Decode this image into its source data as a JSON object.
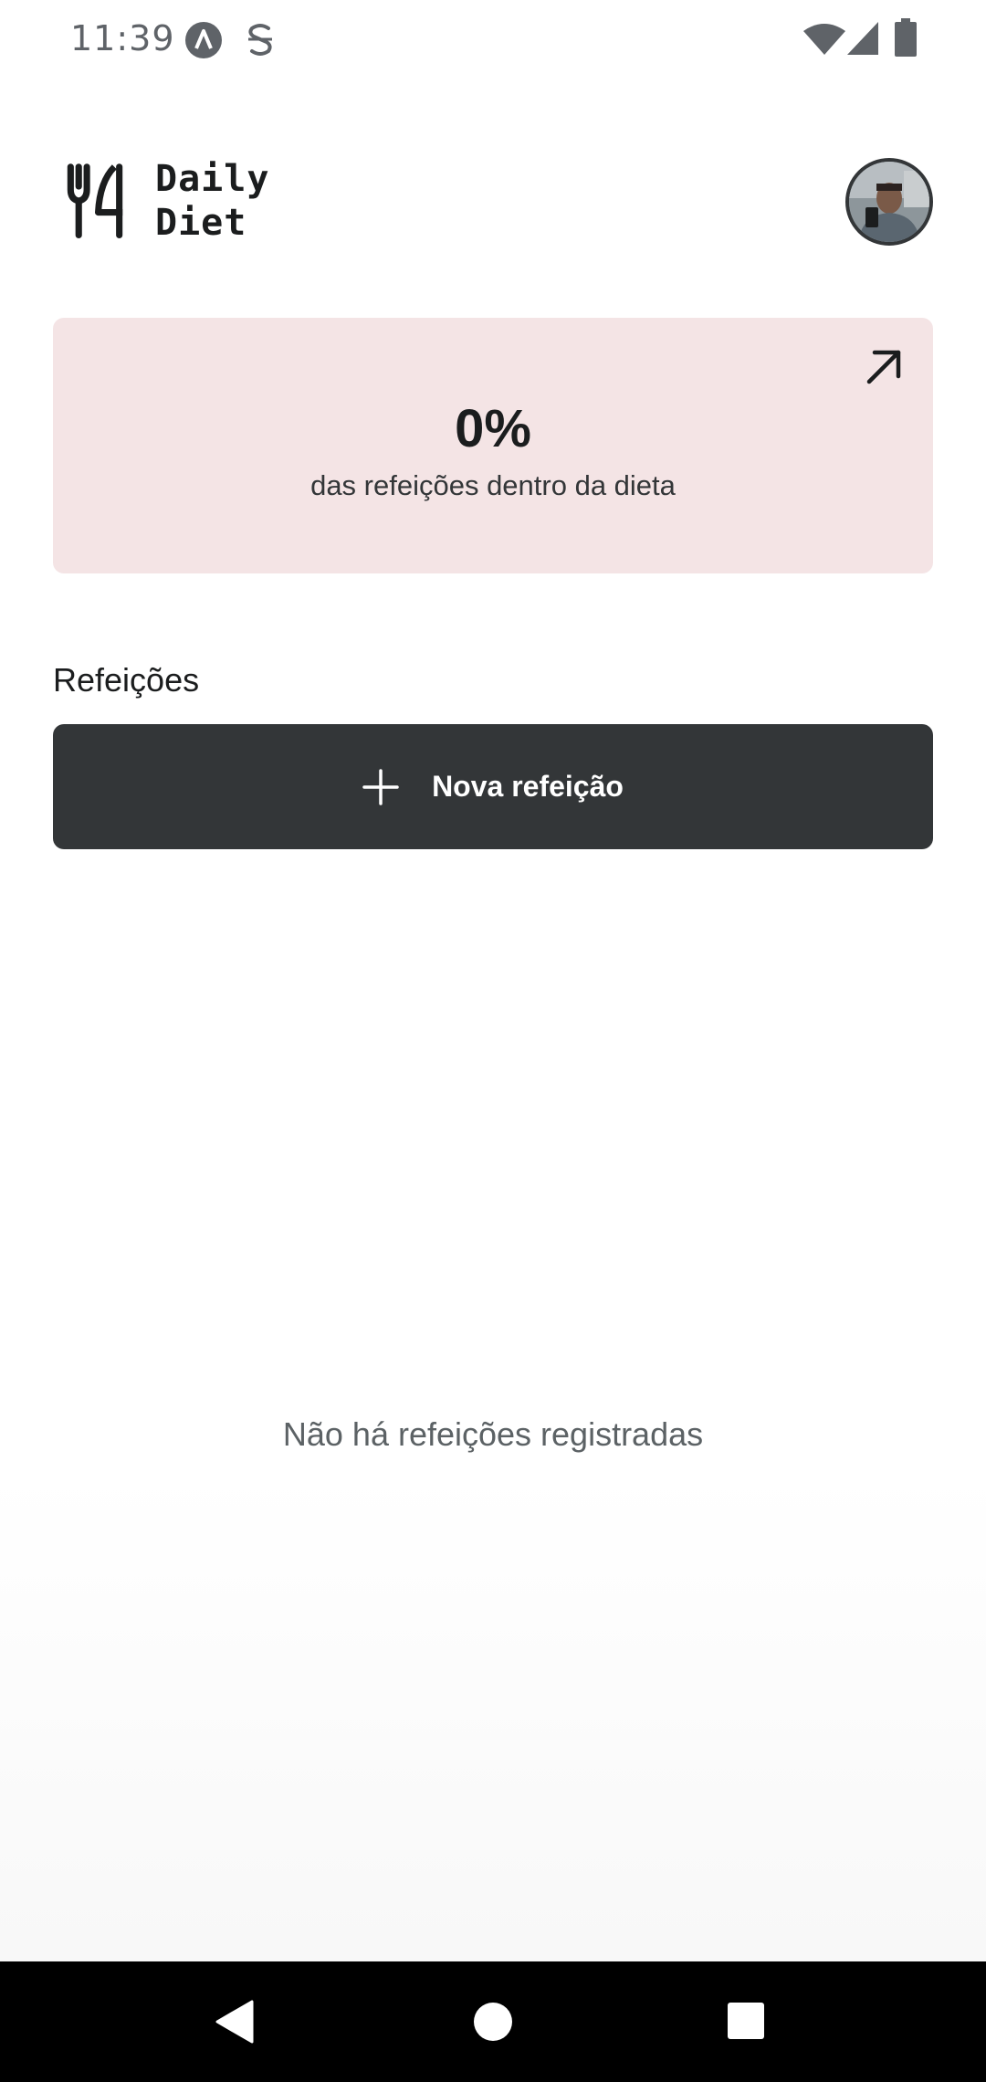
{
  "status_bar": {
    "time": "11:39",
    "icons": [
      "app-icon-a",
      "app-icon-s",
      "wifi-icon",
      "signal-icon",
      "battery-icon"
    ]
  },
  "header": {
    "logo_line1": "Daily",
    "logo_line2": "Diet"
  },
  "stats": {
    "percent": "0%",
    "description": "das refeições dentro da dieta",
    "background": "#f4e4e5",
    "open_icon": "arrow-up-right-icon"
  },
  "meals": {
    "title": "Refeições",
    "new_button_label": "Nova refeição",
    "empty_message": "Não há refeições registradas"
  },
  "colors": {
    "button_bg": "#333638",
    "text_dark": "#1b1d1e"
  },
  "nav_bar": {
    "icons": [
      "back-icon",
      "home-icon",
      "recents-icon"
    ]
  }
}
